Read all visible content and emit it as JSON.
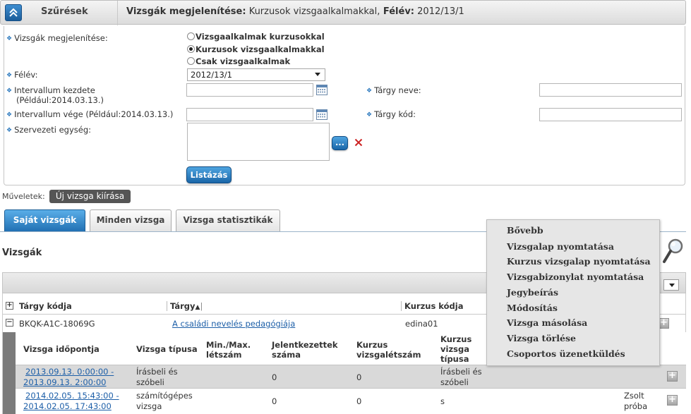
{
  "header": {
    "title": "Szűrések",
    "summary_label_1": "Vizsgák megjelenítése:",
    "summary_value_1": " Kurzusok vizsgaalkalmakkal,",
    "summary_label_2": " Félév:",
    "summary_value_2": " 2012/13/1"
  },
  "filters": {
    "display_label": "Vizsgák megjelenítése:",
    "display_options": [
      {
        "label": "Vizsgaalkalmak kurzusokkal",
        "checked": false
      },
      {
        "label": "Kurzusok vizsgaalkalmakkal",
        "checked": true
      },
      {
        "label": "Csak vizsgaalkalmak",
        "checked": false
      }
    ],
    "semester_label": "Félév:",
    "semester_value": "2012/13/1",
    "interval_start_label": "Intervallum kezdete",
    "interval_start_hint": "(Például:2014.03.13.)",
    "interval_end_label": "Intervallum vége (Például:2014.03.13.)",
    "org_unit_label": "Szervezeti egység:",
    "subject_name_label": "Tárgy neve:",
    "subject_code_label": "Tárgy kód:",
    "browse_label": "...",
    "list_button": "Listázás"
  },
  "ops": {
    "label": "Műveletek:",
    "new_exam": "Új vizsga kiírása"
  },
  "tabs": [
    {
      "label": "Saját vizsgák",
      "active": true
    },
    {
      "label": "Minden vizsga",
      "active": false
    },
    {
      "label": "Vizsga statisztikák",
      "active": false
    }
  ],
  "section_title": "Vizsgák",
  "grid": {
    "headers": {
      "subject_code": "Tárgy kódja",
      "subject": "Tárgy",
      "course_code": "Kurzus kódja"
    },
    "row": {
      "subject_code": "BKQK-A1C-18069G",
      "subject": "A családi nevelés pedagógiája",
      "course_code": "edina01"
    }
  },
  "subgrid": {
    "headers": {
      "time": "Vizsga időpontja",
      "type": "Vizsga típusa",
      "minmax_1": "Min./Max.",
      "minmax_2": "létszám",
      "registered_1": "Jelentkezettek",
      "registered_2": "száma",
      "course_count_1": "Kurzus",
      "course_count_2": "vizsgalétszám",
      "course_type_1": "Kurzus",
      "course_type_2": "vizsga",
      "course_type_3": "típusa"
    },
    "rows": [
      {
        "time_1": "2013.09.13. 0:00:00 -",
        "time_2": "2013.09.13. 2:00:00",
        "type_1": "Írásbeli és",
        "type_2": "szóbeli",
        "registered": "0",
        "course_count": "0",
        "course_type_1": "Írásbeli és",
        "course_type_2": "szóbeli",
        "extra_1": "",
        "extra_2": ""
      },
      {
        "time_1": "2014.02.05. 15:43:00 -",
        "time_2": "2014.02.05. 17:43:00",
        "type_1": "számítógépes",
        "type_2": "vizsga",
        "registered": "0",
        "course_count": "0",
        "course_type_1": "s",
        "course_type_2": "",
        "extra_1": "Zsolt",
        "extra_2": "próba"
      }
    ]
  },
  "context_menu": {
    "items": [
      "Bővebb",
      "Vizsgalap nyomtatása",
      "Kurzus vizsgalap nyomtatása",
      "Vizsgabizonylat nyomtatása",
      "Jegybeírás",
      "Módosítás",
      "Vizsga másolása",
      "Vizsga törlése",
      "Csoportos üzenetküldés"
    ]
  },
  "colors": {
    "accent": "#2170b3",
    "link": "#1d5fa8",
    "delete": "#cc2222"
  }
}
